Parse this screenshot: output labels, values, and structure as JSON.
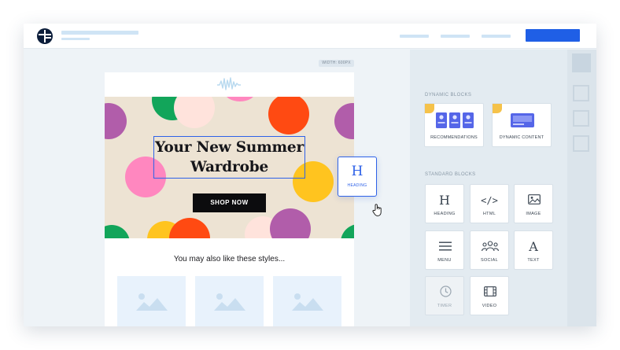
{
  "canvas": {
    "width_tag": "WIDTH: 600PX"
  },
  "email": {
    "hero_title": "Your New Summer Wardrobe",
    "shop_button": "SHOP NOW",
    "also_like": "You may also like these styles..."
  },
  "drag_preview": {
    "glyph": "H",
    "label": "HEADING"
  },
  "panel": {
    "dynamic_title": "DYNAMIC BLOCKS",
    "dynamic_blocks": [
      {
        "label": "RECOMMENDATIONS",
        "icon": "recommendations-icon"
      },
      {
        "label": "DYNAMIC CONTENT",
        "icon": "dynamic-content-icon"
      }
    ],
    "standard_title": "STANDARD BLOCKS",
    "standard_blocks": [
      {
        "label": "HEADING",
        "icon": "heading-icon"
      },
      {
        "label": "HTML",
        "icon": "html-icon"
      },
      {
        "label": "IMAGE",
        "icon": "image-icon"
      },
      {
        "label": "MENU",
        "icon": "menu-icon"
      },
      {
        "label": "SOCIAL",
        "icon": "social-icon"
      },
      {
        "label": "TEXT",
        "icon": "text-icon"
      },
      {
        "label": "TIMER",
        "icon": "timer-icon"
      },
      {
        "label": "VIDEO",
        "icon": "video-icon"
      }
    ],
    "glyphs": {
      "heading": "H",
      "html": "</>",
      "text": "A"
    }
  },
  "colors": {
    "accent": "#2e62e8",
    "primary_button": "#1f5fe6",
    "badge": "#f5c24a",
    "dot_green": "#12a55a",
    "dot_red": "#ff4a12",
    "dot_purple": "#b15daa",
    "dot_pink": "#ff87bf",
    "dot_yellow": "#ffc41f",
    "dot_blush": "#ffe3dc"
  }
}
